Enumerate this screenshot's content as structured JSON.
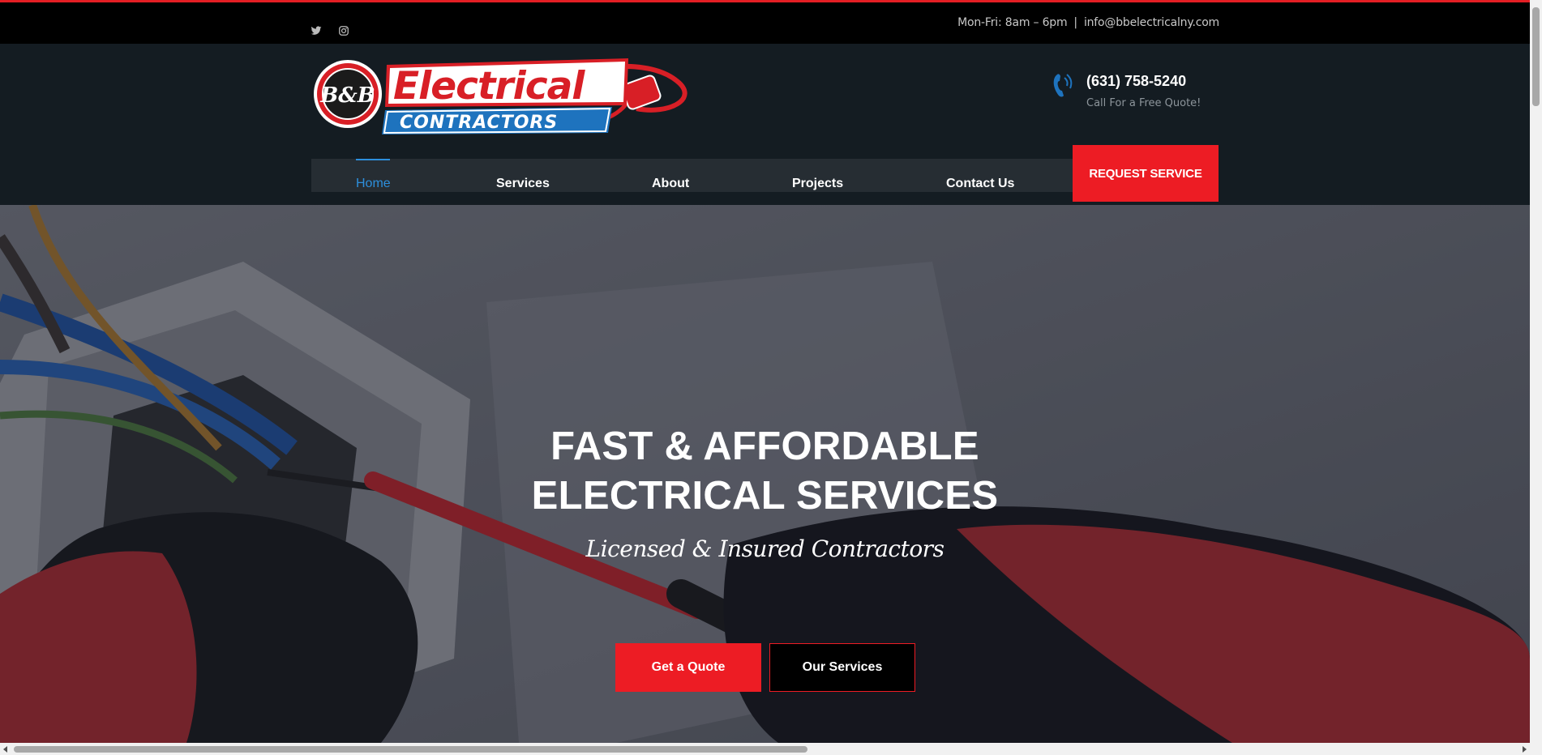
{
  "topbar": {
    "hours": "Mon-Fri: 8am – 6pm",
    "separator": "|",
    "email": "info@bbelectricalny.com",
    "social": [
      "twitter-icon",
      "instagram-icon"
    ]
  },
  "logo": {
    "monogram": "B&B",
    "word1": "Electrical",
    "word2": "CONTRACTORS"
  },
  "contact": {
    "phone": "(631) 758-5240",
    "tagline": "Call For a Free Quote!"
  },
  "nav": {
    "items": [
      {
        "label": "Home",
        "active": true
      },
      {
        "label": "Services",
        "active": false
      },
      {
        "label": "About",
        "active": false
      },
      {
        "label": "Projects",
        "active": false
      },
      {
        "label": "Contact Us",
        "active": false
      }
    ],
    "cta": "REQUEST SERVICE"
  },
  "hero": {
    "title_line1": "FAST & AFFORDABLE",
    "title_line2": "ELECTRICAL SERVICES",
    "subtitle": "Licensed & Insured Contractors",
    "btn_primary": "Get a Quote",
    "btn_secondary": "Our Services"
  },
  "colors": {
    "accent_red": "#ed1c24",
    "link_blue": "#2d8fdc",
    "header_bg": "#141c22"
  }
}
